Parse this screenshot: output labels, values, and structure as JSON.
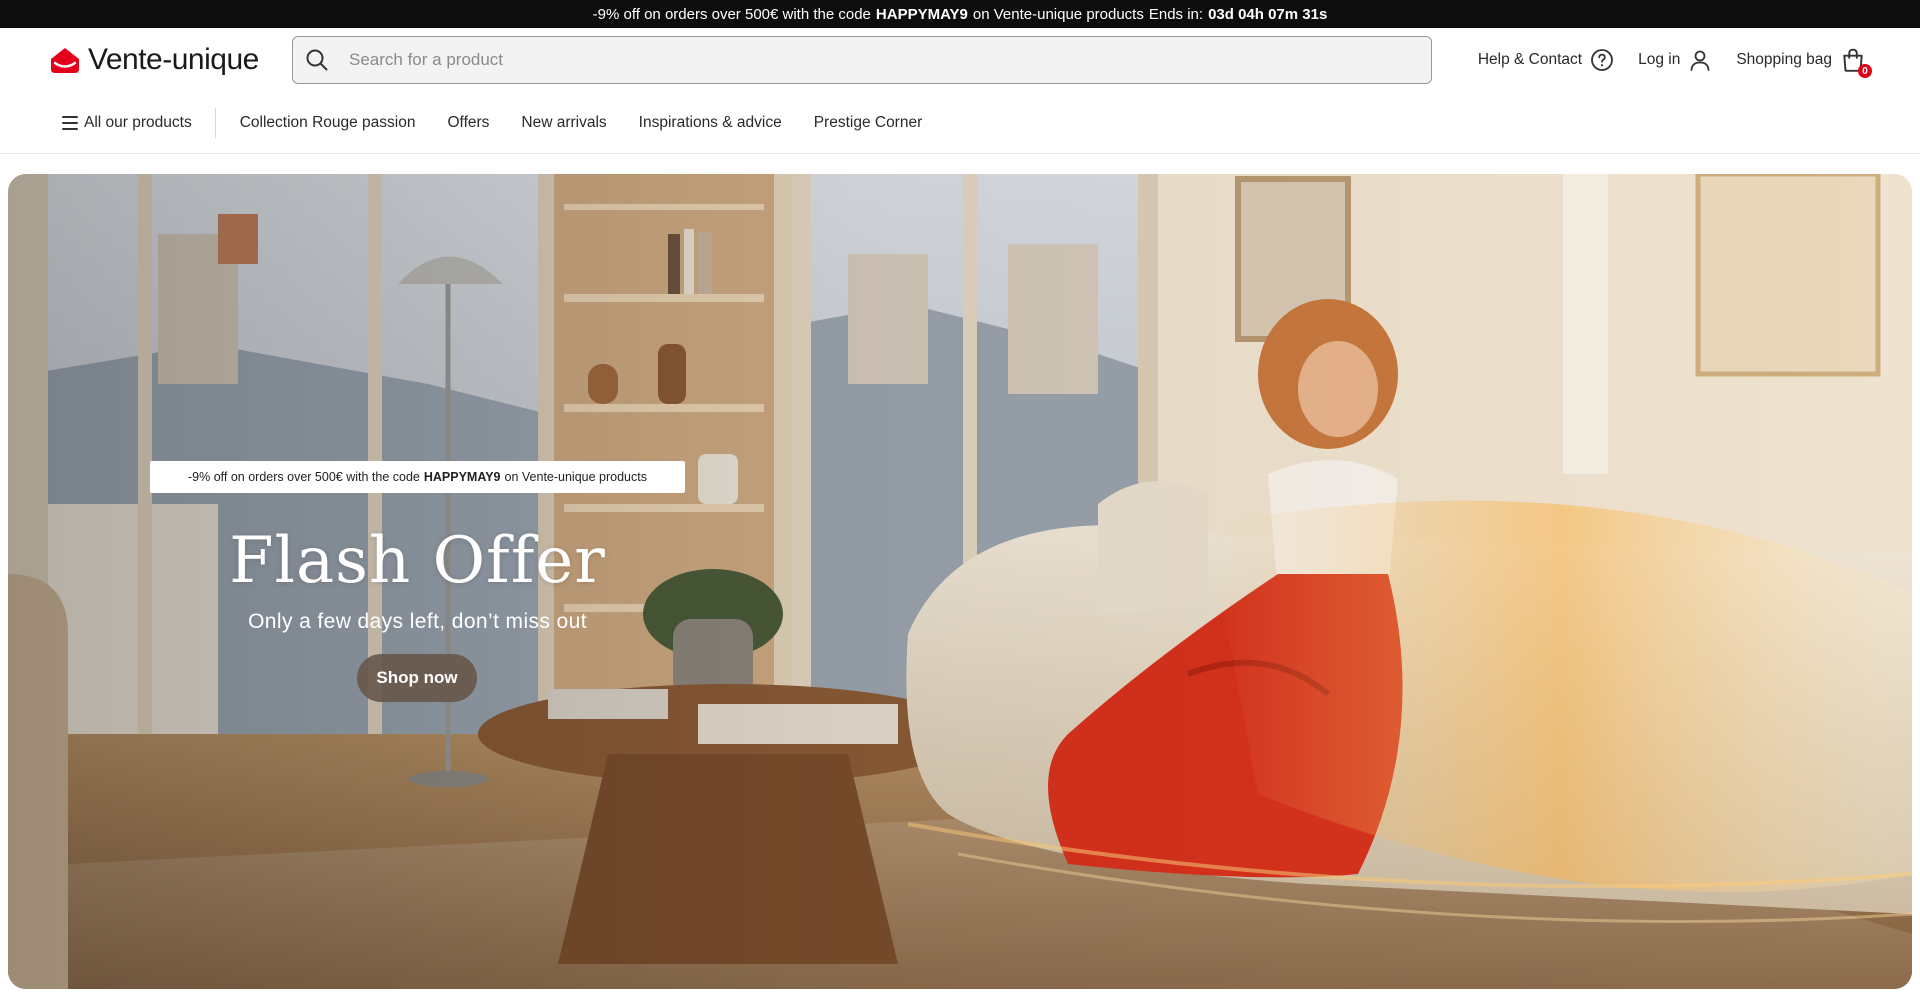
{
  "promo_bar": {
    "text_before": "-9% off on orders over 500€ with the code",
    "code": "HAPPYMAY9",
    "text_after": "on Vente-unique products",
    "ends_label": "Ends in:",
    "countdown": "03d 04h 07m 31s"
  },
  "header": {
    "logo_text": "Vente-unique",
    "search_placeholder": "Search for a product",
    "help_label": "Help & Contact",
    "login_label": "Log in",
    "bag_label": "Shopping bag",
    "bag_count": "0"
  },
  "nav": {
    "all_products": "All our products",
    "items": [
      "Collection Rouge passion",
      "Offers",
      "New arrivals",
      "Inspirations & advice",
      "Prestige Corner"
    ]
  },
  "hero": {
    "promo_before": "-9% off on orders over 500€ with the code",
    "promo_code": "HAPPYMAY9",
    "promo_after": "on Vente-unique products",
    "title": "Flash Offer",
    "subtitle": "Only a few days left, don’t miss out",
    "cta": "Shop now"
  },
  "colors": {
    "brand_red": "#e2001a",
    "promo_bar_bg": "#0d0d0d",
    "cta_bg": "#69584c"
  },
  "icons": [
    "logo-mark-icon",
    "search-icon",
    "help-icon",
    "user-icon",
    "shopping-bag-icon",
    "hamburger-icon"
  ]
}
